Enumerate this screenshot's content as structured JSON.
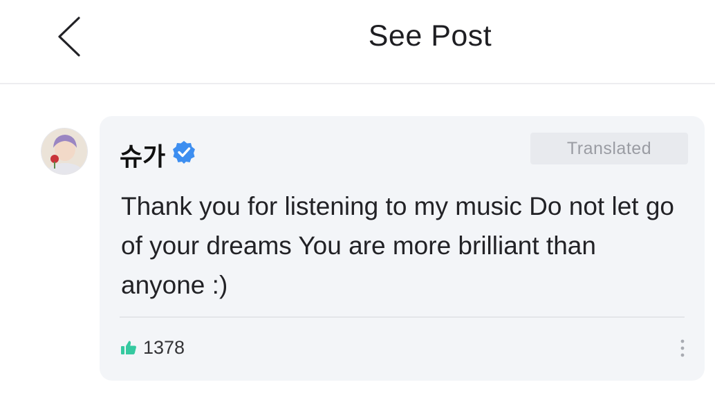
{
  "header": {
    "title": "See Post",
    "back_icon": "chevron-left-icon"
  },
  "post": {
    "author": "슈가",
    "verified": true,
    "verified_color": "#3d8ef0",
    "translated_label": "Translated",
    "text": "Thank you for listening to my music Do not let go of your dreams You are more brilliant than anyone :)",
    "like_count": "1378",
    "like_icon": "thumbs-up-icon",
    "like_color": "#35c9a0",
    "more_icon": "more-vertical-icon"
  }
}
